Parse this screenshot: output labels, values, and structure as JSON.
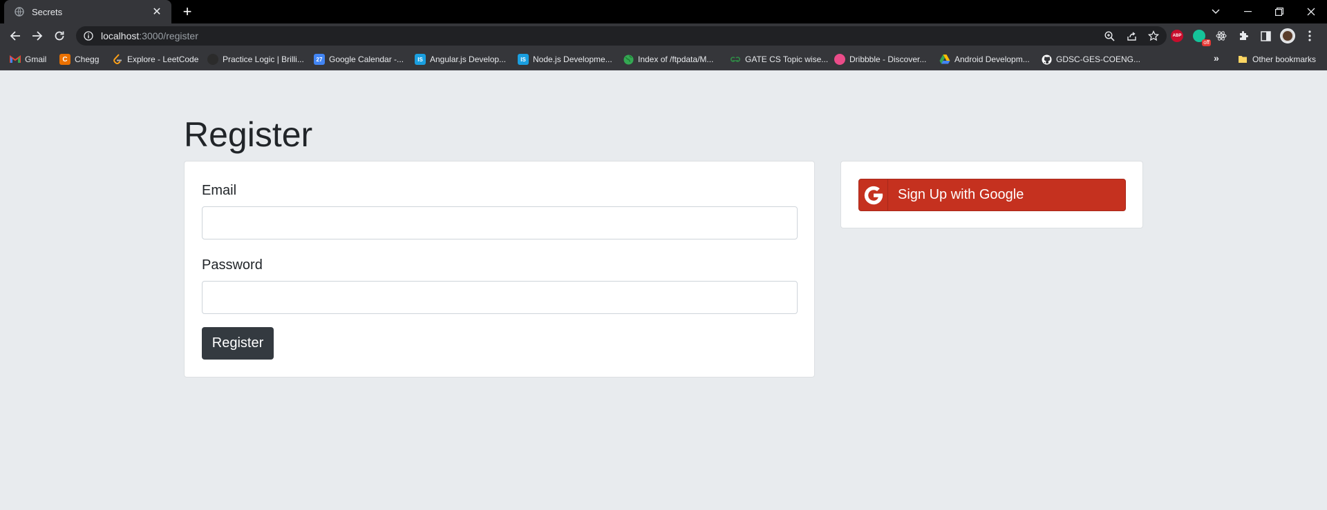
{
  "browser": {
    "tab_title": "Secrets",
    "url_host": "localhost",
    "url_path": ":3000/register",
    "extension_abp_text": "ABP",
    "grammarly_badge": "off"
  },
  "bookmarks": [
    {
      "label": "Gmail",
      "icon": "gmail-icon",
      "color": "#ea4335"
    },
    {
      "label": "Chegg",
      "icon": "chegg-icon",
      "color": "#eb7100",
      "glyph": "C"
    },
    {
      "label": "Explore - LeetCode",
      "icon": "leetcode-icon",
      "color": "#ffa116"
    },
    {
      "label": "Practice Logic | Brilli...",
      "icon": "brilliant-icon",
      "color": "#2b2b2b"
    },
    {
      "label": "Google Calendar -...",
      "icon": "calendar-icon",
      "color": "#4285f4",
      "glyph": "27"
    },
    {
      "label": "Angular.js Develop...",
      "icon": "is-icon",
      "color": "#1a9fe0",
      "glyph": "IS"
    },
    {
      "label": "Node.js Developme...",
      "icon": "is-icon",
      "color": "#1a9fe0",
      "glyph": "IS"
    },
    {
      "label": "Index of /ftpdata/M...",
      "icon": "globe-icon",
      "color": "#34a853"
    },
    {
      "label": "GATE CS Topic wise...",
      "icon": "gfg-icon",
      "color": "#2f8d46"
    },
    {
      "label": "Dribbble - Discover...",
      "icon": "dribbble-icon",
      "color": "#ea4c89"
    },
    {
      "label": "Android Developm...",
      "icon": "drive-icon",
      "color": "#fbbc04"
    },
    {
      "label": "GDSC-GES-COENG...",
      "icon": "github-icon",
      "color": "#ffffff"
    }
  ],
  "other_bookmarks": "Other bookmarks",
  "page": {
    "title": "Register",
    "email_label": "Email",
    "email_value": "",
    "password_label": "Password",
    "password_value": "",
    "submit_label": "Register",
    "google_label": "Sign Up with Google",
    "google_color": "#c5311f",
    "dark_button_color": "#343a40"
  }
}
